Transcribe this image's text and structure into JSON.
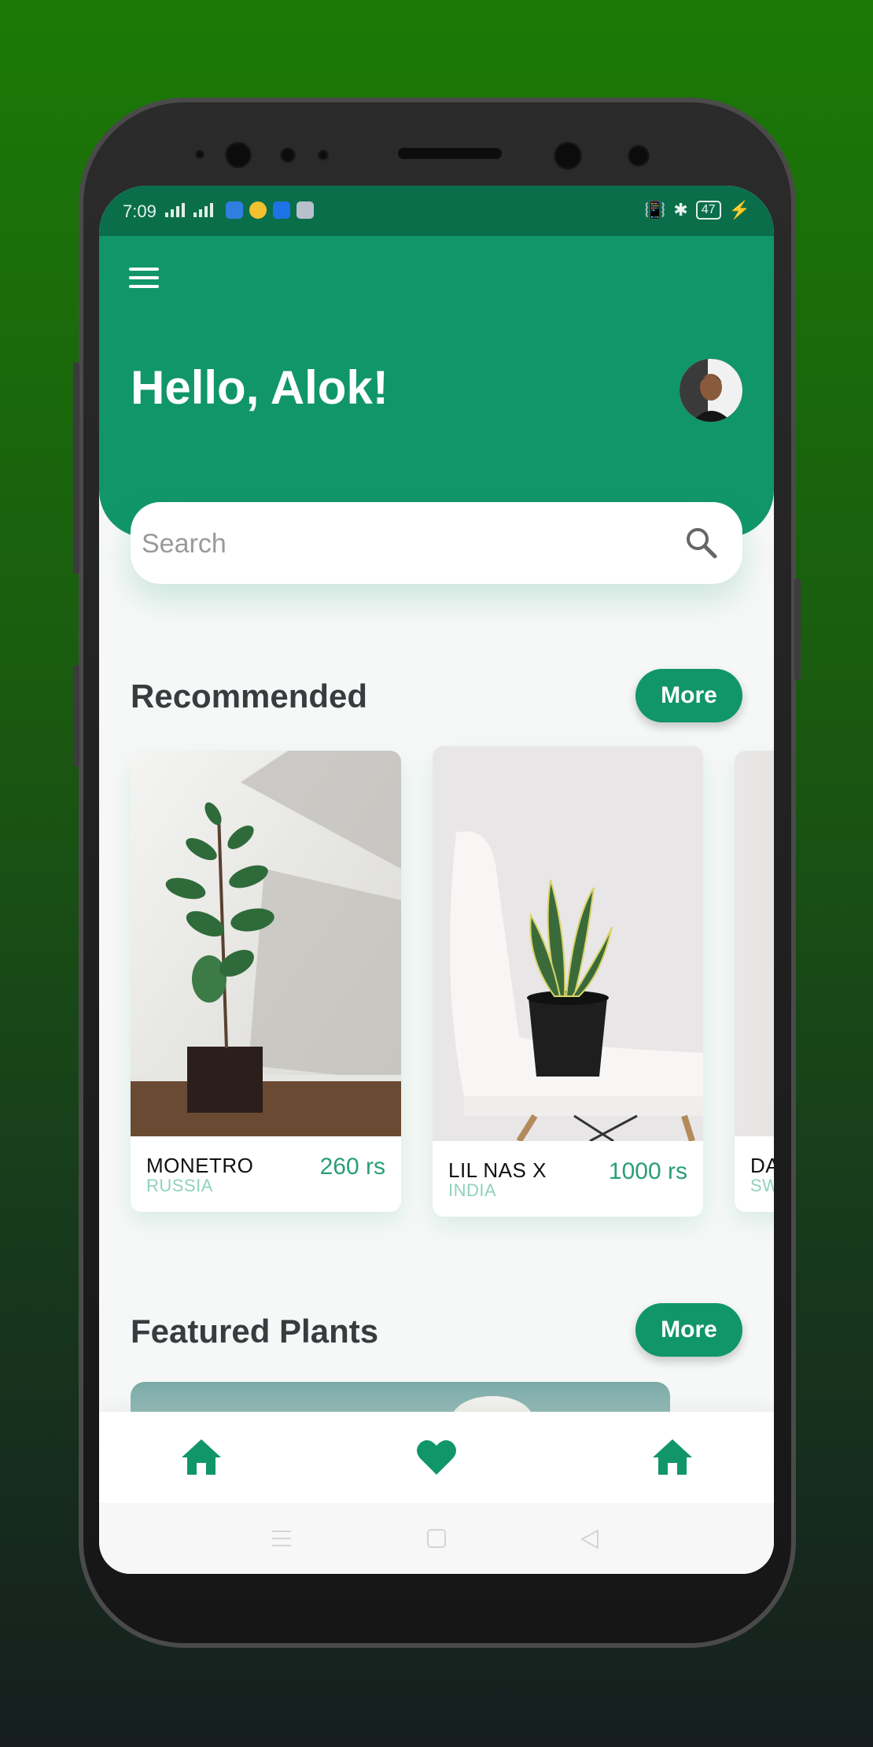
{
  "colors": {
    "primary": "#119669",
    "status_bar": "#0a6e4b",
    "price": "#2a9e74",
    "country": "#8fd3b8"
  },
  "status_bar": {
    "time": "7:09",
    "battery": "47"
  },
  "header": {
    "greeting": "Hello, Alok!",
    "menu_icon": "hamburger-menu-icon",
    "avatar": "user-avatar"
  },
  "search": {
    "placeholder": "Search",
    "icon": "search-icon"
  },
  "recommended": {
    "title": "Recommended",
    "more_label": "More",
    "cards": [
      {
        "name": "MONETRO",
        "country": "RUSSIA",
        "price": "260 rs"
      },
      {
        "name": "LIL NAS X",
        "country": "INDIA",
        "price": "1000 rs"
      },
      {
        "name": "DA",
        "country": "SW",
        "price": ""
      }
    ]
  },
  "featured": {
    "title": "Featured Plants",
    "more_label": "More"
  },
  "bottom_nav": {
    "items": [
      "home-icon",
      "heart-icon",
      "home-icon"
    ]
  },
  "system_nav": {
    "items": [
      "recents-icon",
      "home-square-icon",
      "back-triangle-icon"
    ]
  }
}
